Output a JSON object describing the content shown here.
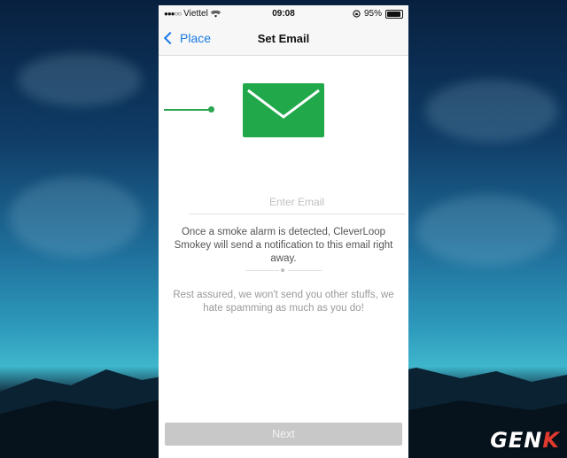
{
  "status_bar": {
    "carrier": "Viettel",
    "signal_dots": "●●●○○",
    "time": "09:08",
    "battery_percent_label": "95%",
    "battery_level": 0.95
  },
  "nav": {
    "back_label": "Place",
    "title": "Set Email"
  },
  "email": {
    "placeholder": "Enter Email",
    "value": ""
  },
  "description": "Once a smoke alarm is detected, CleverLoop Smokey will send a notification to this email right away.",
  "reassurance": "Rest assured, we won't send you other stuffs, we hate spamming as much as you do!",
  "next_button_label": "Next",
  "watermark": "GENK",
  "colors": {
    "accent_blue": "#1a7ae6",
    "envelope_green": "#20a84b",
    "button_disabled": "#c8c8c8"
  }
}
